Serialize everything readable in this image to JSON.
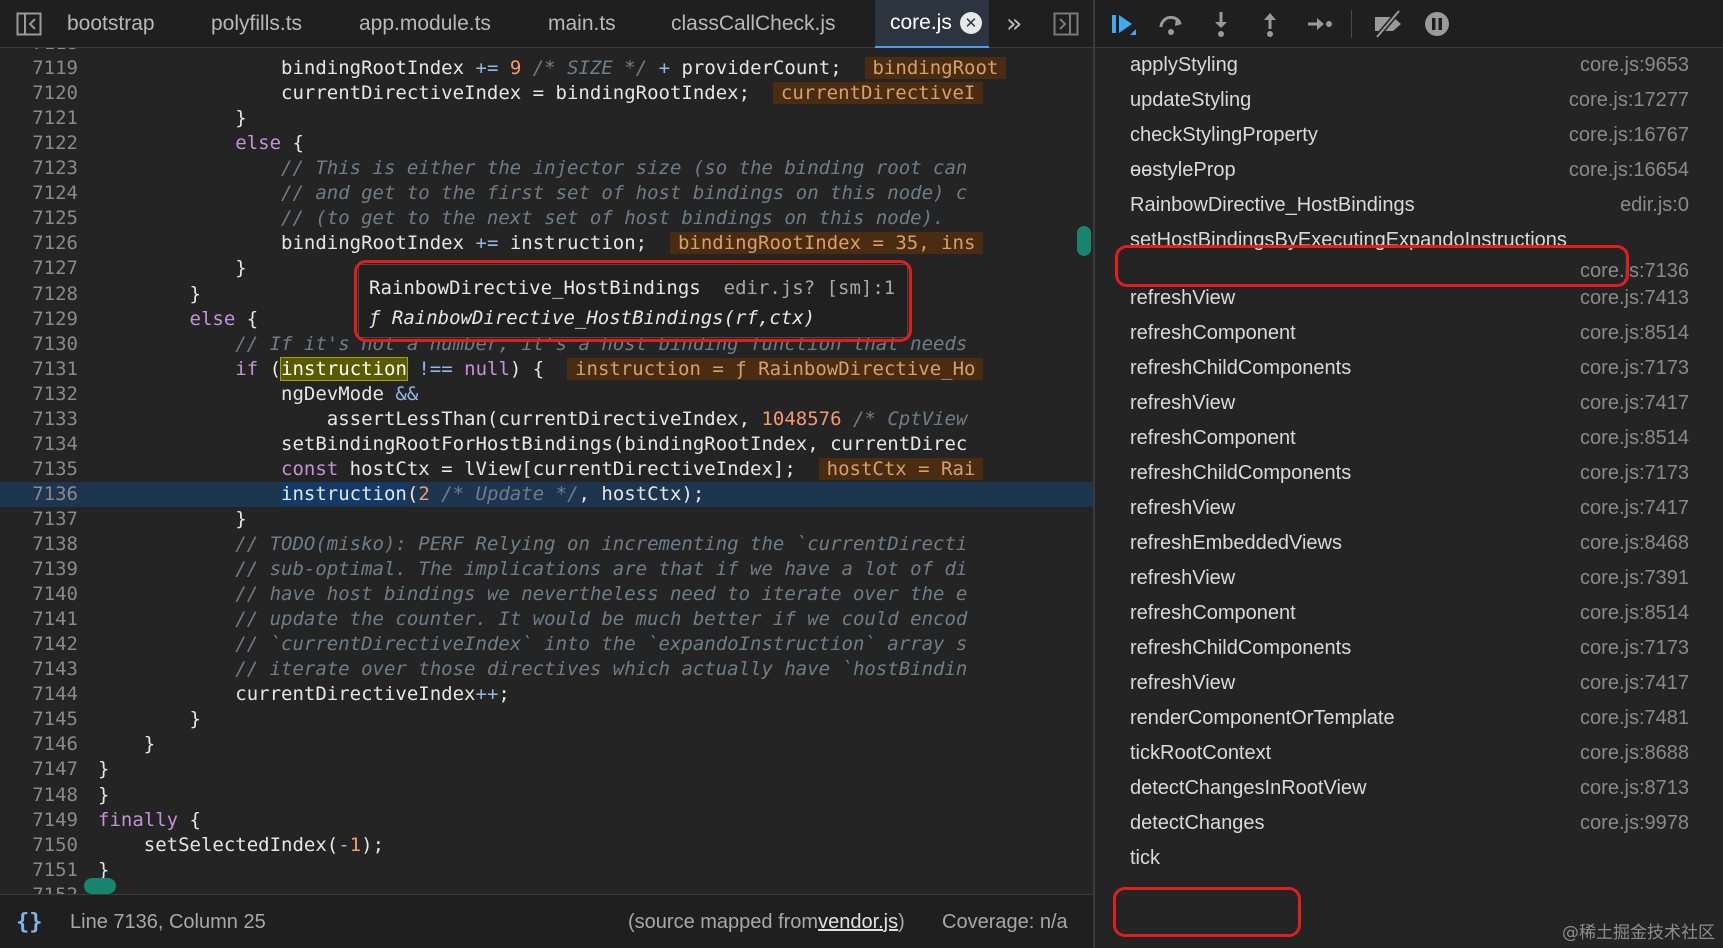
{
  "editor": {
    "tabs": [
      {
        "label": "bootstrap"
      },
      {
        "label": "polyfills.ts"
      },
      {
        "label": "app.module.ts"
      },
      {
        "label": "main.ts"
      },
      {
        "label": "classCallCheck.js"
      },
      {
        "label": "core.js",
        "active": true
      }
    ],
    "overflow_icon": "chevron-double-right-icon",
    "sidebar_toggle_icon": "panel-left-icon",
    "debugger_toggle_icon": "panel-right-icon",
    "lines": [
      {
        "n": "7118",
        "segs": []
      },
      {
        "n": "7119",
        "segs": [
          [
            "t",
            "                bindingRootIndex "
          ],
          [
            "op",
            "+="
          ],
          [
            "t",
            " "
          ],
          [
            "num",
            "9"
          ],
          [
            "t",
            " "
          ],
          [
            "cm",
            "/* SIZE */"
          ],
          [
            "t",
            " "
          ],
          [
            "op",
            "+"
          ],
          [
            "t",
            " providerCount;  "
          ],
          [
            "iv",
            "bindingRoot"
          ]
        ]
      },
      {
        "n": "7120",
        "segs": [
          [
            "t",
            "                currentDirectiveIndex = bindingRootIndex;  "
          ],
          [
            "iv",
            "currentDirectiveI"
          ]
        ]
      },
      {
        "n": "7121",
        "segs": [
          [
            "t",
            "            }"
          ]
        ]
      },
      {
        "n": "7122",
        "segs": [
          [
            "t",
            "            "
          ],
          [
            "kw",
            "else"
          ],
          [
            "t",
            " {"
          ]
        ]
      },
      {
        "n": "7123",
        "segs": [
          [
            "t",
            "                "
          ],
          [
            "cm",
            "// This is either the injector size (so the binding root can"
          ]
        ]
      },
      {
        "n": "7124",
        "segs": [
          [
            "t",
            "                "
          ],
          [
            "cm",
            "// and get to the first set of host bindings on this node) c"
          ]
        ]
      },
      {
        "n": "7125",
        "segs": [
          [
            "t",
            "                "
          ],
          [
            "cm",
            "// (to get to the next set of host bindings on this node)."
          ]
        ]
      },
      {
        "n": "7126",
        "segs": [
          [
            "t",
            "                bindingRootIndex "
          ],
          [
            "op",
            "+="
          ],
          [
            "t",
            " instruction;  "
          ],
          [
            "iv",
            "bindingRootIndex = 35, ins"
          ]
        ]
      },
      {
        "n": "7127",
        "segs": [
          [
            "t",
            "            }"
          ]
        ]
      },
      {
        "n": "7128",
        "segs": [
          [
            "t",
            "        }"
          ]
        ]
      },
      {
        "n": "7129",
        "segs": [
          [
            "t",
            "        "
          ],
          [
            "kw",
            "else"
          ],
          [
            "t",
            " {"
          ]
        ]
      },
      {
        "n": "7130",
        "segs": [
          [
            "t",
            "            "
          ],
          [
            "cm",
            "// If it's not a number, it's a host binding function that needs"
          ]
        ]
      },
      {
        "n": "7131",
        "segs": [
          [
            "t",
            "            "
          ],
          [
            "kw",
            "if"
          ],
          [
            "t",
            " ("
          ],
          [
            "hw",
            "instruction"
          ],
          [
            "t",
            " "
          ],
          [
            "op",
            "!=="
          ],
          [
            "t",
            " "
          ],
          [
            "kw",
            "null"
          ],
          [
            "t",
            ") {  "
          ],
          [
            "iv",
            "instruction = ƒ RainbowDirective_Ho"
          ]
        ]
      },
      {
        "n": "7132",
        "segs": [
          [
            "t",
            "                ngDevMode "
          ],
          [
            "op",
            "&&"
          ]
        ]
      },
      {
        "n": "7133",
        "segs": [
          [
            "t",
            "                    assertLessThan(currentDirectiveIndex, "
          ],
          [
            "num",
            "1048576"
          ],
          [
            "t",
            " "
          ],
          [
            "cm",
            "/* CptView"
          ]
        ]
      },
      {
        "n": "7134",
        "segs": [
          [
            "t",
            "                setBindingRootForHostBindings(bindingRootIndex, currentDirec"
          ]
        ]
      },
      {
        "n": "7135",
        "segs": [
          [
            "t",
            "                "
          ],
          [
            "kw",
            "const"
          ],
          [
            "t",
            " hostCtx = lView[currentDirectiveIndex];  "
          ],
          [
            "iv",
            "hostCtx = Rai"
          ]
        ]
      },
      {
        "n": "7136",
        "current": true,
        "segs": [
          [
            "t",
            "                "
          ],
          [
            "hc",
            "instruction"
          ],
          [
            "t",
            "("
          ],
          [
            "num",
            "2"
          ],
          [
            "t",
            " "
          ],
          [
            "cm",
            "/* Update */"
          ],
          [
            "t",
            ", hostCtx);"
          ]
        ]
      },
      {
        "n": "7137",
        "segs": [
          [
            "t",
            "            }"
          ]
        ]
      },
      {
        "n": "7138",
        "segs": [
          [
            "t",
            "            "
          ],
          [
            "cm",
            "// TODO(misko): PERF Relying on incrementing the `currentDirecti"
          ]
        ]
      },
      {
        "n": "7139",
        "segs": [
          [
            "t",
            "            "
          ],
          [
            "cm",
            "// sub-optimal. The implications are that if we have a lot of di"
          ]
        ]
      },
      {
        "n": "7140",
        "segs": [
          [
            "t",
            "            "
          ],
          [
            "cm",
            "// have host bindings we nevertheless need to iterate over the e"
          ]
        ]
      },
      {
        "n": "7141",
        "segs": [
          [
            "t",
            "            "
          ],
          [
            "cm",
            "// update the counter. It would be much better if we could encod"
          ]
        ]
      },
      {
        "n": "7142",
        "segs": [
          [
            "t",
            "            "
          ],
          [
            "cm",
            "// `currentDirectiveIndex` into the `expandoInstruction` array s"
          ]
        ]
      },
      {
        "n": "7143",
        "segs": [
          [
            "t",
            "            "
          ],
          [
            "cm",
            "// iterate over those directives which actually have `hostBindin"
          ]
        ]
      },
      {
        "n": "7144",
        "segs": [
          [
            "t",
            "            currentDirectiveIndex"
          ],
          [
            "op",
            "++"
          ],
          [
            "t",
            ";"
          ]
        ]
      },
      {
        "n": "7145",
        "segs": [
          [
            "t",
            "        }"
          ]
        ]
      },
      {
        "n": "7146",
        "segs": [
          [
            "t",
            "    }"
          ]
        ]
      },
      {
        "n": "7147",
        "segs": [
          [
            "t",
            "}"
          ]
        ]
      },
      {
        "n": "7148",
        "segs": [
          [
            "t",
            "}"
          ]
        ]
      },
      {
        "n": "7149",
        "segs": [
          [
            "kw",
            "finally"
          ],
          [
            "t",
            " {"
          ]
        ]
      },
      {
        "n": "7150",
        "segs": [
          [
            "t",
            "    setSelectedIndex("
          ],
          [
            "op",
            "-"
          ],
          [
            "num",
            "1"
          ],
          [
            "t",
            ");"
          ]
        ]
      },
      {
        "n": "7151",
        "segs": [
          [
            "t",
            "}"
          ]
        ]
      },
      {
        "n": "7152",
        "segs": []
      }
    ],
    "tooltip": {
      "title": "RainbowDirective_HostBindings",
      "location": "edir.js? [sm]:1",
      "signature": "ƒ RainbowDirective_HostBindings(rf,ctx)"
    },
    "status": {
      "braces": "{}",
      "position": "Line 7136, Column 25",
      "source_prefix": "(source mapped from ",
      "source_link": "vendor.js",
      "source_suffix": ")",
      "coverage": "Coverage: n/a"
    }
  },
  "debugger": {
    "toolbar_icons": [
      "resume-icon",
      "step-over-icon",
      "step-into-icon",
      "step-out-icon",
      "step-icon",
      "deactivate-breakpoints-icon",
      "pause-on-exceptions-icon"
    ],
    "frames": [
      {
        "name": "applyStyling",
        "loc": "core.js:9653"
      },
      {
        "name": "updateStyling",
        "loc": "core.js:17277"
      },
      {
        "name": "checkStylingProperty",
        "loc": "core.js:16767"
      },
      {
        "name": "ɵɵstyleProp",
        "loc": "core.js:16654"
      },
      {
        "name": "RainbowDirective_HostBindings",
        "loc": "edir.js:0"
      },
      {
        "name": "setHostBindingsByExecutingExpandoInstructions",
        "loc": "core.js:7136",
        "highlighted": true
      },
      {
        "name": "refreshView",
        "loc": "core.js:7413"
      },
      {
        "name": "refreshComponent",
        "loc": "core.js:8514"
      },
      {
        "name": "refreshChildComponents",
        "loc": "core.js:7173"
      },
      {
        "name": "refreshView",
        "loc": "core.js:7417"
      },
      {
        "name": "refreshComponent",
        "loc": "core.js:8514"
      },
      {
        "name": "refreshChildComponents",
        "loc": "core.js:7173"
      },
      {
        "name": "refreshView",
        "loc": "core.js:7417"
      },
      {
        "name": "refreshEmbeddedViews",
        "loc": "core.js:8468"
      },
      {
        "name": "refreshView",
        "loc": "core.js:7391"
      },
      {
        "name": "refreshComponent",
        "loc": "core.js:8514"
      },
      {
        "name": "refreshChildComponents",
        "loc": "core.js:7173"
      },
      {
        "name": "refreshView",
        "loc": "core.js:7417"
      },
      {
        "name": "renderComponentOrTemplate",
        "loc": "core.js:7481"
      },
      {
        "name": "tickRootContext",
        "loc": "core.js:8688"
      },
      {
        "name": "detectChangesInRootView",
        "loc": "core.js:8713"
      },
      {
        "name": "detectChanges",
        "loc": "core.js:9978",
        "highlighted": true
      },
      {
        "name": "tick",
        "loc": ""
      }
    ]
  },
  "watermark": "@稀土掘金技术社区",
  "colors": {
    "annotation_red": "#e01e1e",
    "accent_teal": "#18846f",
    "resume_blue": "#3fa8f5"
  }
}
